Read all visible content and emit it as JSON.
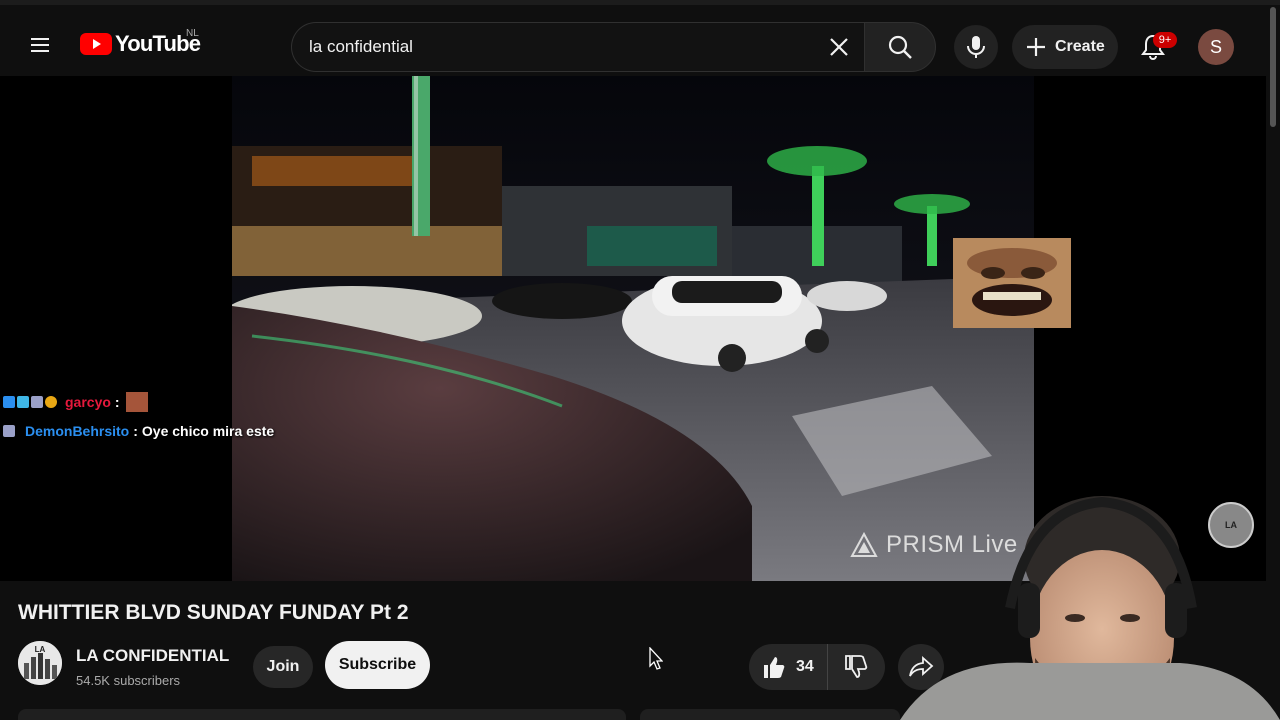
{
  "header": {
    "logo_text": "YouTube",
    "region_code": "NL",
    "search_value": "la confidential",
    "create_label": "Create",
    "notification_count": "9+",
    "avatar_initial": "S"
  },
  "player": {
    "chat": [
      {
        "user": "garcyo",
        "separator": ":",
        "message": ""
      },
      {
        "user": "DemonBehrsito",
        "separator": ":",
        "message": "Oye chico mira este"
      }
    ],
    "overlay_brand": "PRISM Live",
    "watermark_text": "LA"
  },
  "video": {
    "title": "WHITTIER BLVD SUNDAY FUNDAY Pt 2",
    "channel_name": "LA CONFIDENTIAL",
    "subscriber_count": "54.5K subscribers",
    "join_label": "Join",
    "subscribe_label": "Subscribe",
    "like_count": "34"
  },
  "colors": {
    "background": "#0f0f0f",
    "brand_red": "#ff0000",
    "chat_user_1": "#e6193c",
    "chat_user_2": "#2b8ff0",
    "subscribe_bg": "#f1f1f1"
  },
  "icons": [
    "menu-icon",
    "youtube-play-icon",
    "close-icon",
    "search-icon",
    "microphone-icon",
    "plus-icon",
    "bell-icon",
    "like-icon",
    "dislike-icon",
    "share-icon",
    "prism-logo-icon",
    "mouse-cursor-icon"
  ]
}
